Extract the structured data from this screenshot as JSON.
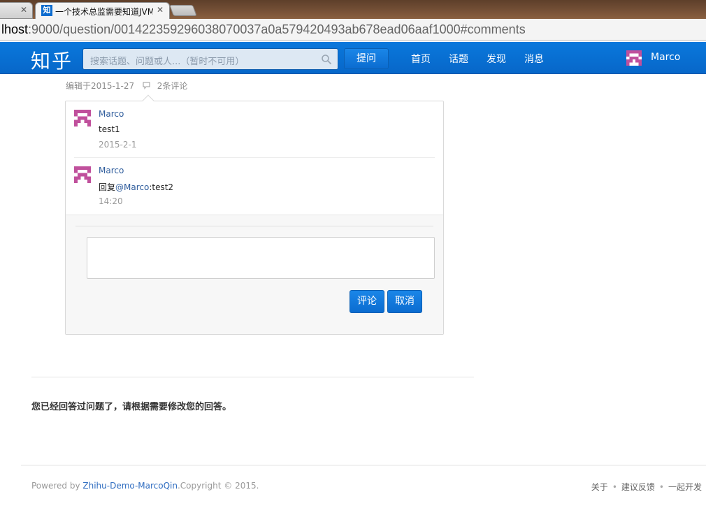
{
  "browser": {
    "active_tab_title": "一个技术总监需要知道JVM",
    "active_tab_favicon": "知",
    "address_host": "lhost",
    "address_rest": ":9000/question/0014223592960380700 37a0a579420493ab678ead06aaf1000#comments"
  },
  "nav": {
    "logo": "知乎",
    "search_placeholder": "搜索话题、问题或人...（暂时不可用）",
    "ask_label": "提问",
    "links": [
      "首页",
      "话题",
      "发现",
      "消息"
    ],
    "user_name": "Marco"
  },
  "answer_meta": {
    "edited": "编辑于2015-1-27",
    "comment_count": "2条评论"
  },
  "comments": [
    {
      "author": "Marco",
      "text": "test1",
      "date": "2015-2-1"
    },
    {
      "author": "Marco",
      "text_prefix": "回复",
      "mention": "@Marco",
      "text_suffix": ":test2",
      "date": "14:20"
    }
  ],
  "composer": {
    "value": "",
    "submit_label": "评论",
    "cancel_label": "取消"
  },
  "notice": "您已经回答过问题了，请根据需要修改您的回答。",
  "footer": {
    "powered_prefix": "Powered by ",
    "powered_link": "Zhihu-Demo-MarcoQin",
    "copyright": ".Copyright © 2015.",
    "links": [
      "关于",
      "建议反馈",
      "一起开发"
    ]
  },
  "colors": {
    "nav_blue": "#0a78dc",
    "link_blue": "#2e5c9c",
    "avatar_pink": "#c0509c"
  }
}
